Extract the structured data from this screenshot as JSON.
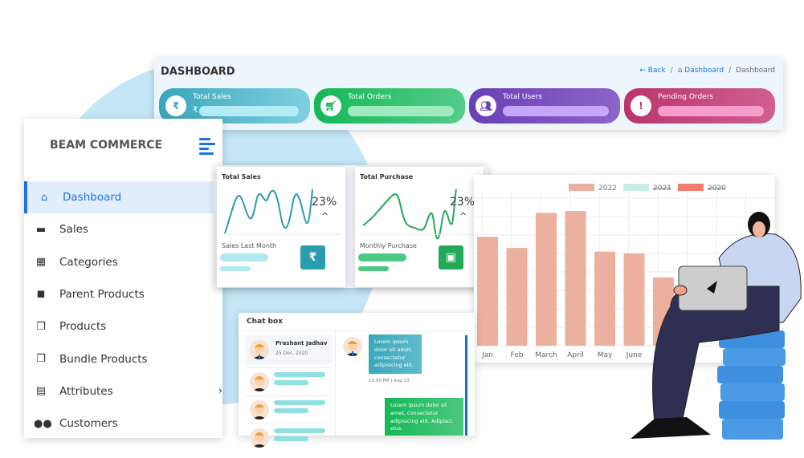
{
  "header": {
    "title": "DASHBOARD",
    "breadcrumb": {
      "back": "Back",
      "sep": "/",
      "home": "Dashboard",
      "current": "Dashboard"
    }
  },
  "stats": [
    {
      "label": "Total Sales",
      "icon": "rupee-icon",
      "prefix": "₹",
      "colors": [
        "#3aa6bb",
        "#7fd0e0"
      ],
      "bar": "#b3ecf4"
    },
    {
      "label": "Total Orders",
      "icon": "cart-icon",
      "colors": [
        "#15b857",
        "#56cc8a"
      ],
      "bar": "#a0eac0"
    },
    {
      "label": "Total Users",
      "icon": "users-icon",
      "colors": [
        "#6a3fb5",
        "#8b65c8"
      ],
      "bar": "#c6a6fb"
    },
    {
      "label": "Pending Orders",
      "icon": "exclamation-icon",
      "colors": [
        "#b9346d",
        "#d06091"
      ],
      "bar": "#f79dcc"
    }
  ],
  "sidebar": {
    "brand": "BEAM COMMERCE",
    "items": [
      {
        "label": "Dashboard",
        "icon": "home-icon",
        "active": true
      },
      {
        "label": "Sales",
        "icon": "money-icon",
        "submenu": true
      },
      {
        "label": "Categories",
        "icon": "grid-icon"
      },
      {
        "label": "Parent Products",
        "icon": "tiles-icon"
      },
      {
        "label": "Products",
        "icon": "boxes-icon"
      },
      {
        "label": "Bundle Products",
        "icon": "boxes-icon"
      },
      {
        "label": "Attributes",
        "icon": "file-icon",
        "submenu": true
      },
      {
        "label": "Customers",
        "icon": "users-icon"
      }
    ]
  },
  "cards": [
    {
      "title": "Total Sales",
      "percent": "23%",
      "sub": "Sales Last Month",
      "color": "#2a9cb0",
      "icon": "rupee-icon",
      "icon_glyph": "₹"
    },
    {
      "title": "Total Purchase",
      "percent": "23%",
      "sub": "Monthly Purchase",
      "color": "#22aa5a",
      "icon": "cash-icon",
      "icon_glyph": "▣"
    }
  ],
  "chart_data": {
    "type": "bar",
    "categories": [
      "Jan",
      "Feb",
      "March",
      "April",
      "May",
      "June",
      "July"
    ],
    "series": [
      {
        "name": "2022",
        "values": [
          59,
          53,
          72,
          73,
          51,
          50,
          37
        ],
        "color": "#ebb09e"
      }
    ],
    "legend": [
      {
        "name": "2022",
        "color": "#ebb09e",
        "hidden": false
      },
      {
        "name": "2021",
        "color": "#c8ede6",
        "hidden": true
      },
      {
        "name": "2020",
        "color": "#f27c6e",
        "hidden": true
      }
    ],
    "yticks": [
      "20",
      "30"
    ],
    "ylim": [
      0,
      84
    ],
    "grid": true,
    "legend_placement": "top"
  },
  "chat": {
    "title": "Chat box",
    "contact": {
      "name": "Prashant Jadhav",
      "date": "25 Dec, 2020"
    },
    "msg1": "Lorem ipsum dolor sit amet, consectetur adipisicing elit.",
    "time1": "12:00 PM | Aug 13",
    "msg2": "Lorem ipsum dolor sit amet, consectetur adipisicing elit. Adipisci, eius."
  }
}
